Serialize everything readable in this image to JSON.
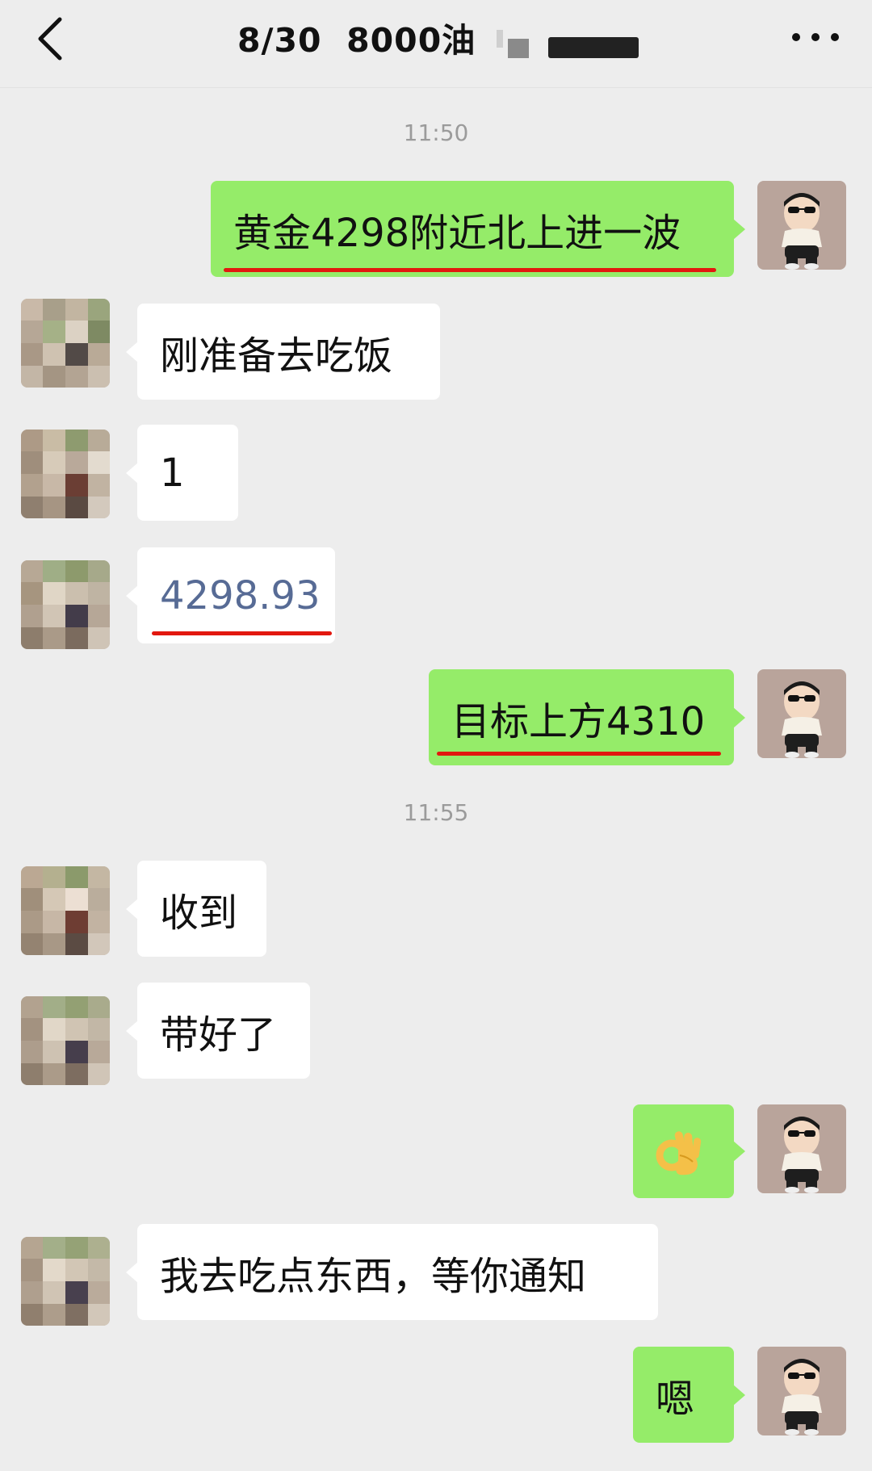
{
  "header": {
    "title": "8/30  8000油",
    "back_icon": "chevron-left-icon",
    "more_icon": "more-dots-icon"
  },
  "colors": {
    "background": "#ededed",
    "outgoing_bubble": "#95ec69",
    "incoming_bubble": "#ffffff",
    "link_text": "#576b95",
    "annotation_underline": "#e2180f"
  },
  "timestamps": [
    "11:50",
    "11:55"
  ],
  "messages": [
    {
      "side": "out",
      "text": "黄金4298附近北上进一波",
      "underlined": true
    },
    {
      "side": "in",
      "text": "刚准备去吃饭"
    },
    {
      "side": "in",
      "text": "1"
    },
    {
      "side": "in",
      "text": "4298.93",
      "style": "link",
      "underlined": true
    },
    {
      "side": "out",
      "text": "目标上方4310",
      "underlined": true
    },
    {
      "side": "in",
      "text": "收到"
    },
    {
      "side": "in",
      "text": "带好了"
    },
    {
      "side": "out",
      "text": "👌",
      "kind": "emoji",
      "icon": "ok-hand-emoji-icon"
    },
    {
      "side": "in",
      "text": "我去吃点东西，等你通知"
    },
    {
      "side": "out",
      "text": "嗯"
    }
  ],
  "avatars": {
    "self": "cartoon-boy-sunglasses-avatar",
    "contact": "pixelated-avatar"
  }
}
